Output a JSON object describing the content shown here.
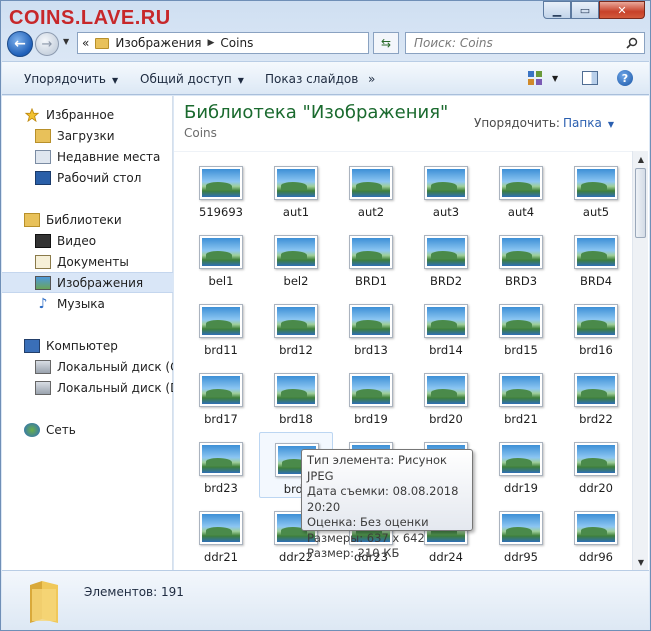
{
  "watermark": "COINS.LAVE.RU",
  "address": {
    "back_glyph": "←",
    "forward_glyph": "→",
    "chevrons": "«",
    "crumbs": [
      "Изображения",
      "Coins"
    ],
    "search_placeholder": "Поиск: Coins"
  },
  "toolbar": {
    "organize": "Упорядочить",
    "share": "Общий доступ",
    "slideshow": "Показ слайдов",
    "more": "»",
    "help": "?"
  },
  "nav": {
    "favorites": "Избранное",
    "downloads": "Загрузки",
    "recent": "Недавние места",
    "desktop": "Рабочий стол",
    "libraries": "Библиотеки",
    "video": "Видео",
    "documents": "Документы",
    "images": "Изображения",
    "music": "Музыка",
    "computer": "Компьютер",
    "disk_c": "Локальный диск (C",
    "disk_d": "Локальный диск (D",
    "network": "Сеть"
  },
  "content": {
    "library_title": "Библиотека \"Изображения\"",
    "library_subtitle": "Coins",
    "arrange_label": "Упорядочить:",
    "arrange_value": "Папка"
  },
  "files": [
    "519693",
    "aut1",
    "aut2",
    "aut3",
    "aut4",
    "aut5",
    "bel1",
    "bel2",
    "BRD1",
    "BRD2",
    "BRD3",
    "BRD4",
    "brd11",
    "brd12",
    "brd13",
    "brd14",
    "brd15",
    "brd16",
    "brd17",
    "brd18",
    "brd19",
    "brd20",
    "brd21",
    "brd22",
    "brd23",
    "brd2",
    "",
    "",
    "ddr19",
    "ddr20",
    "ddr21",
    "ddr22",
    "ddr23",
    "ddr24",
    "ddr95",
    "ddr96"
  ],
  "tooltip": {
    "type": "Тип элемента: Рисунок JPEG",
    "date": "Дата съемки: 08.08.2018 20:20",
    "rating": "Оценка: Без оценки",
    "dimensions": "Размеры: 637 x 642",
    "size": "Размер: 210 КБ"
  },
  "status": {
    "count": "Элементов: 191"
  }
}
